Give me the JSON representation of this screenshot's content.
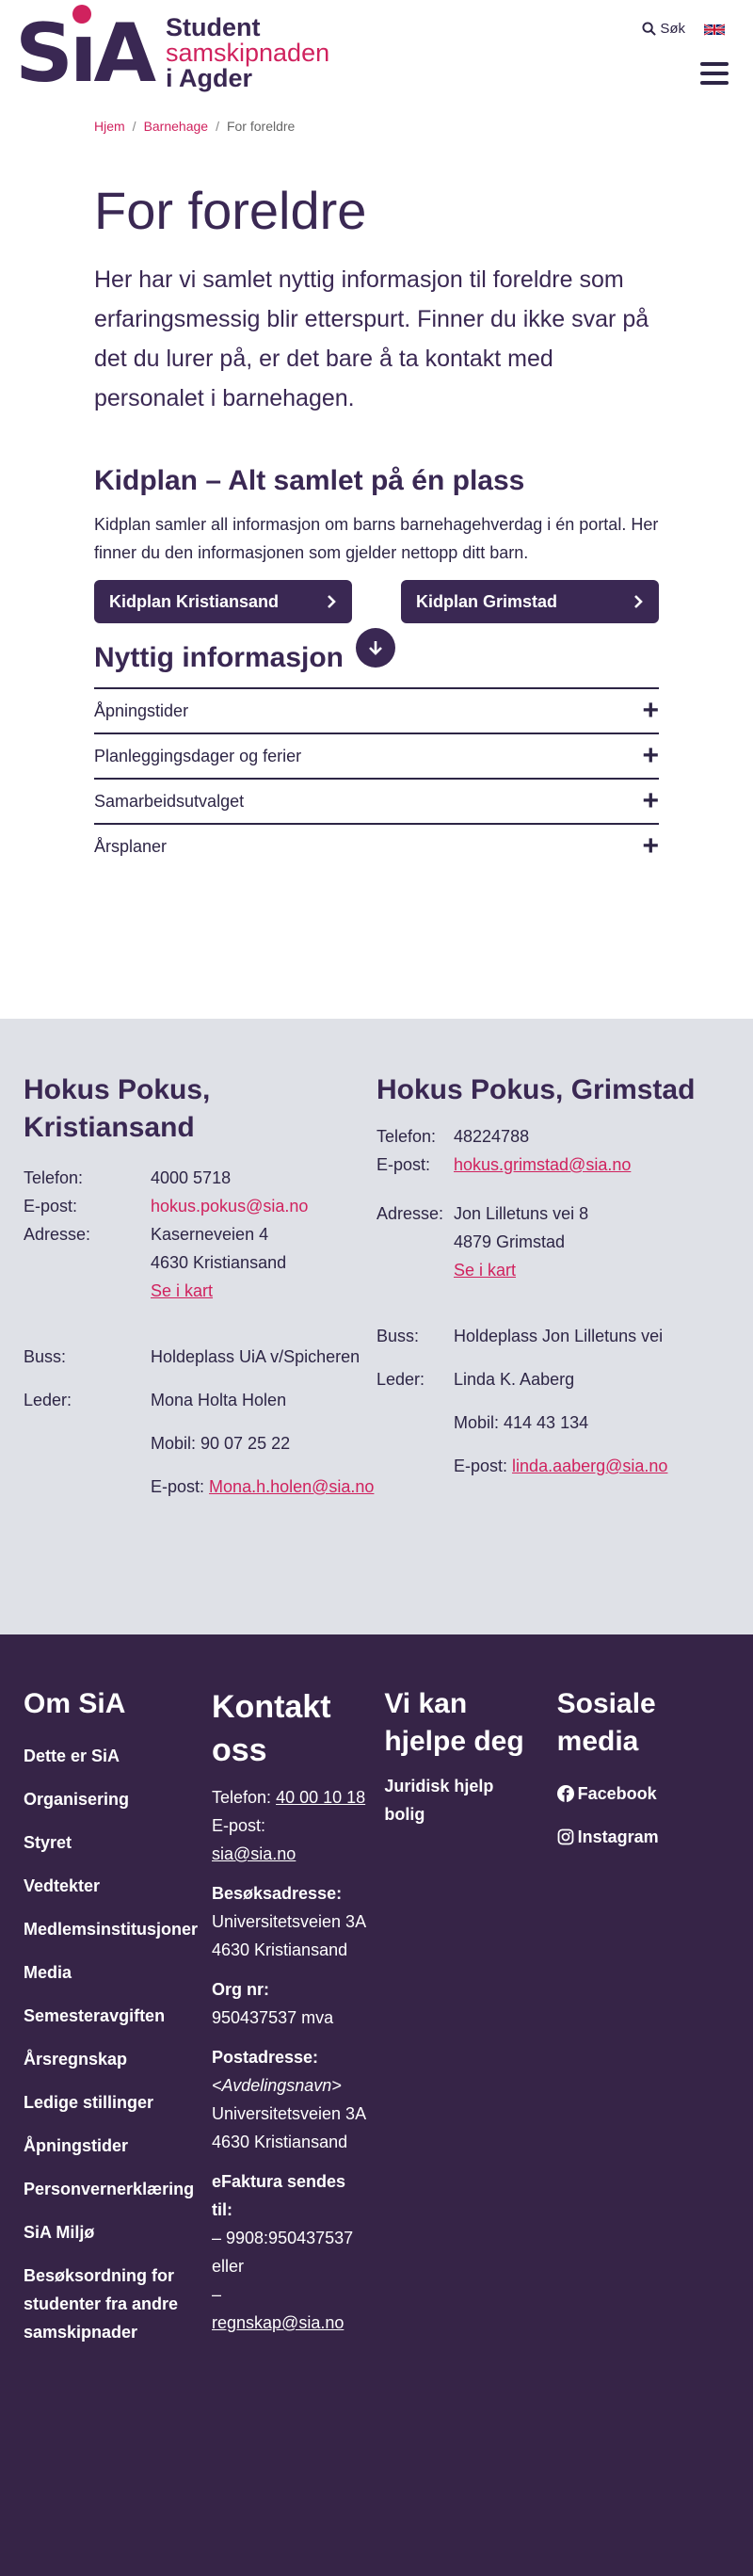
{
  "header": {
    "logo_mark": "SiA",
    "logo_line1": "Student",
    "logo_line2": "samskipnaden",
    "logo_line3": "i Agder",
    "search_label": "Søk"
  },
  "breadcrumb": {
    "home": "Hjem",
    "parent": "Barnehage",
    "current": "For foreldre",
    "sep": "/"
  },
  "page": {
    "title": "For foreldre",
    "lead": "Her har vi samlet nyttig informasjon til foreldre som erfaringsmessig blir etterspurt. Finner du ikke svar på det du lurer på, er det bare å ta kontakt med personalet i barnehagen.",
    "kidplan_heading": "Kidplan – Alt samlet på én plass",
    "kidplan_intro": "Kidplan samler all informasjon om barns barnehagehverdag i én portal. Her finner du den informasjonen som gjelder nettopp ditt barn.",
    "btn_kristiansand": "Kidplan Kristiansand",
    "btn_grimstad": "Kidplan Grimstad",
    "info_heading": "Nyttig informasjon",
    "accordion": [
      "Åpningstider",
      "Planleggingsdager og ferier",
      "Samarbeidsutvalget",
      "Årsplaner"
    ]
  },
  "contact": {
    "kristiansand": {
      "title": "Hokus Pokus, Kristiansand",
      "phone_label": "Telefon:",
      "phone": "4000 5718",
      "email_label": "E-post:",
      "email": "hokus.pokus@sia.no",
      "address_label": "Adresse:",
      "address1": "Kaserneveien 4",
      "address2": "4630 Kristiansand",
      "map": "Se i kart",
      "bus_label": "Buss:",
      "bus": "Holdeplass UiA v/Spicheren",
      "leader_label": "Leder:",
      "leader": "Mona Holta Holen",
      "mobile": "Mobil: 90 07 25 22",
      "leader_email_label": "E-post:",
      "leader_email": "Mona.h.holen@sia.no"
    },
    "grimstad": {
      "title": "Hokus Pokus, Grimstad",
      "phone_label": "Telefon:",
      "phone": "48224788",
      "email_label": "E-post:",
      "email": "hokus.grimstad@sia.no",
      "address_label": "Adresse:",
      "address1": "Jon Lilletuns vei 8",
      "address2": "4879 Grimstad",
      "map": "Se i kart",
      "bus_label": "Buss:",
      "bus": "Holdeplass Jon Lilletuns vei",
      "leader_label": "Leder:",
      "leader": "Linda K. Aaberg",
      "mobile": "Mobil: 414 43 134",
      "leader_email_label": "E-post:",
      "leader_email": "linda.aaberg@sia.no"
    }
  },
  "footer": {
    "om": {
      "title": "Om SiA",
      "links": [
        "Dette er SiA",
        "Organisering",
        "Styret",
        "Vedtekter",
        "Medlemsinstitusjoner",
        "Media",
        "Semesteravgiften",
        "Årsregnskap",
        "Ledige stillinger",
        "Åpningstider",
        "Personvernerklæring",
        "SiA Miljø"
      ],
      "last_link": "Besøksordning for studenter fra andre samskipnader"
    },
    "kontakt": {
      "title": "Kontakt oss",
      "phone_label": "Telefon:",
      "phone": "40 00 10 18",
      "email_label": "E-post:",
      "email": "sia@sia.no",
      "visit_label": "Besøksadresse:",
      "visit": "Universitetsveien 3A 4630 Kristiansand",
      "org_label": "Org nr:",
      "org": "950437537 mva",
      "post_label": "Postadresse:",
      "post_dept": "<Avdelingsnavn>",
      "post": "Universitetsveien 3A 4630 Kristiansand",
      "efaktura_label": "eFaktura sendes til:",
      "efaktura1": "– 9908:950437537 eller",
      "efaktura2": "–",
      "efaktura_email": "regnskap@sia.no"
    },
    "hjelp": {
      "title": "Vi kan hjelpe deg",
      "link": "Juridisk hjelp bolig"
    },
    "sosiale": {
      "title": "Sosiale media",
      "facebook": "Facebook",
      "instagram": "Instagram"
    }
  },
  "colors": {
    "primary": "#3a2853",
    "accent": "#d0225e",
    "contact_bg": "#dfe1e7",
    "footer_bg": "#362447"
  }
}
